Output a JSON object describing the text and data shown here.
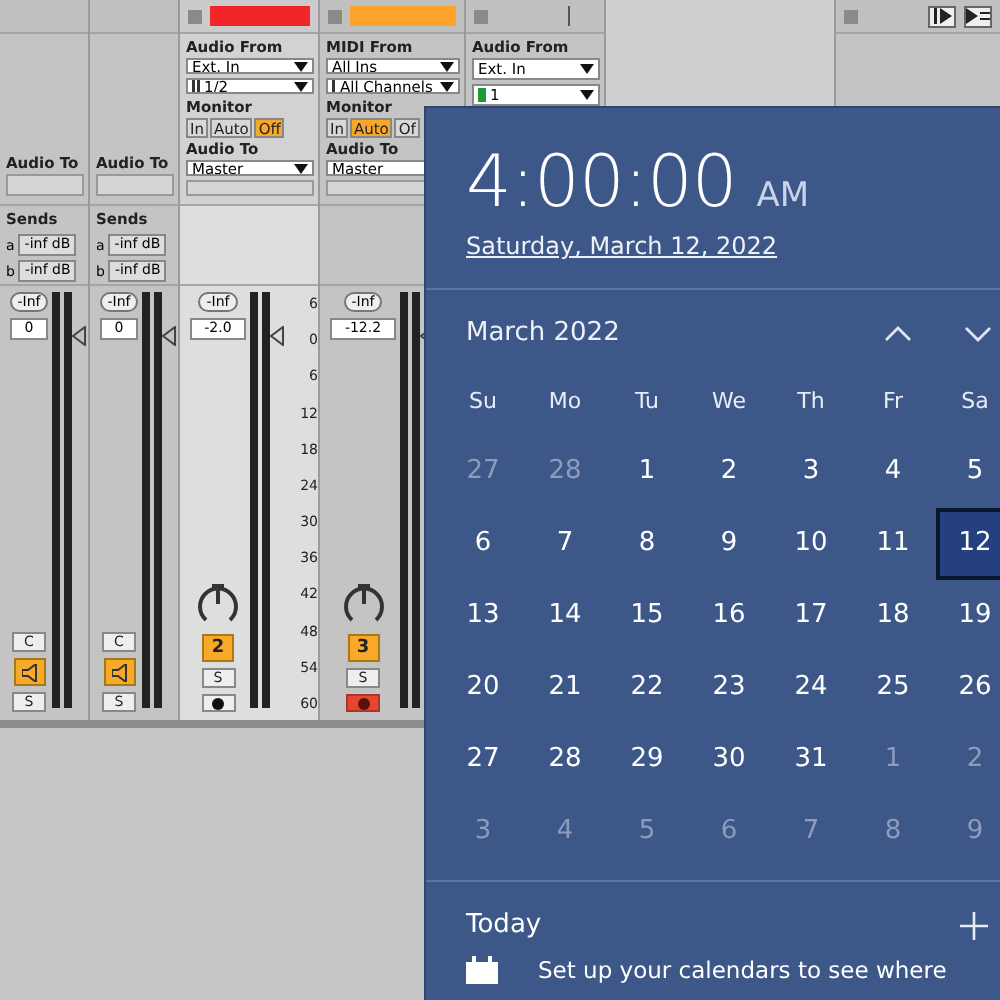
{
  "tracks": [
    {
      "kind": "return",
      "selected": false,
      "io": {
        "to_label": "Audio To"
      },
      "sends_label": "Sends",
      "sends": [
        {
          "letter": "a",
          "value": "-inf dB"
        },
        {
          "letter": "b",
          "value": "-inf dB"
        }
      ],
      "mixer": {
        "peak": "-Inf",
        "volume": "0",
        "pan": {
          "kind": "button",
          "label": "C"
        },
        "activator": {
          "kind": "speaker"
        },
        "solo": "S"
      }
    },
    {
      "kind": "return",
      "selected": false,
      "io": {
        "to_label": "Audio To"
      },
      "sends_label": "Sends",
      "sends": [
        {
          "letter": "a",
          "value": "-inf dB"
        },
        {
          "letter": "b",
          "value": "-inf dB"
        }
      ],
      "mixer": {
        "peak": "-Inf",
        "volume": "0",
        "pan": {
          "kind": "button",
          "label": "C"
        },
        "activator": {
          "kind": "speaker"
        },
        "solo": "S"
      }
    },
    {
      "kind": "audio",
      "selected": true,
      "clip": {
        "kind": "bar",
        "color": "#f0262b"
      },
      "io": {
        "from_label": "Audio From",
        "from": "Ext. In",
        "channel": {
          "kind": "stereo",
          "label": "1/2"
        },
        "monitor_label": "Monitor",
        "monitor": [
          {
            "label": "In",
            "selected": false
          },
          {
            "label": "Auto",
            "selected": false
          },
          {
            "label": "Off",
            "selected": true
          }
        ],
        "to_label": "Audio To",
        "to": "Master"
      },
      "mixer": {
        "peak": "-Inf",
        "volume": "-2.0",
        "scale": [
          "6",
          "0",
          "6",
          "12",
          "18",
          "24",
          "30",
          "36",
          "42",
          "48",
          "54",
          "60"
        ],
        "pan": {
          "kind": "knob"
        },
        "activator": {
          "kind": "number",
          "label": "2"
        },
        "solo": "S",
        "armed": false
      }
    },
    {
      "kind": "midi",
      "selected": false,
      "clip": {
        "kind": "bar",
        "color": "#ffa42a"
      },
      "io": {
        "from_label": "MIDI From",
        "from": "All Ins",
        "channel": {
          "kind": "midi",
          "label": "All Channels"
        },
        "monitor_label": "Monitor",
        "monitor": [
          {
            "label": "In",
            "selected": false
          },
          {
            "label": "Auto",
            "selected": true
          },
          {
            "label": "Of",
            "selected": false
          }
        ],
        "to_label": "Audio To",
        "to": "Master"
      },
      "mixer": {
        "peak": "-Inf",
        "volume": "-12.2",
        "pan": {
          "kind": "knob"
        },
        "activator": {
          "kind": "number",
          "label": "3"
        },
        "solo": "S",
        "armed": true
      }
    },
    {
      "kind": "audio",
      "selected": false,
      "clip": {
        "kind": "empty"
      },
      "io": {
        "from_label": "Audio From",
        "from": "Ext. In",
        "channel": {
          "kind": "mono",
          "label": "1"
        }
      }
    }
  ],
  "clock": {
    "time": "4:00:00",
    "period": "AM",
    "date": "Saturday, March 12, 2022"
  },
  "calendar": {
    "month": "March 2022",
    "weekdays": [
      "Su",
      "Mo",
      "Tu",
      "We",
      "Th",
      "Fr",
      "Sa"
    ],
    "weeks": [
      [
        {
          "day": "27",
          "in_month": false,
          "selected": false
        },
        {
          "day": "28",
          "in_month": false,
          "selected": false
        },
        {
          "day": "1",
          "in_month": true,
          "selected": false
        },
        {
          "day": "2",
          "in_month": true,
          "selected": false
        },
        {
          "day": "3",
          "in_month": true,
          "selected": false
        },
        {
          "day": "4",
          "in_month": true,
          "selected": false
        },
        {
          "day": "5",
          "in_month": true,
          "selected": false
        }
      ],
      [
        {
          "day": "6",
          "in_month": true,
          "selected": false
        },
        {
          "day": "7",
          "in_month": true,
          "selected": false
        },
        {
          "day": "8",
          "in_month": true,
          "selected": false
        },
        {
          "day": "9",
          "in_month": true,
          "selected": false
        },
        {
          "day": "10",
          "in_month": true,
          "selected": false
        },
        {
          "day": "11",
          "in_month": true,
          "selected": false
        },
        {
          "day": "12",
          "in_month": true,
          "selected": true
        }
      ],
      [
        {
          "day": "13",
          "in_month": true,
          "selected": false
        },
        {
          "day": "14",
          "in_month": true,
          "selected": false
        },
        {
          "day": "15",
          "in_month": true,
          "selected": false
        },
        {
          "day": "16",
          "in_month": true,
          "selected": false
        },
        {
          "day": "17",
          "in_month": true,
          "selected": false
        },
        {
          "day": "18",
          "in_month": true,
          "selected": false
        },
        {
          "day": "19",
          "in_month": true,
          "selected": false
        }
      ],
      [
        {
          "day": "20",
          "in_month": true,
          "selected": false
        },
        {
          "day": "21",
          "in_month": true,
          "selected": false
        },
        {
          "day": "22",
          "in_month": true,
          "selected": false
        },
        {
          "day": "23",
          "in_month": true,
          "selected": false
        },
        {
          "day": "24",
          "in_month": true,
          "selected": false
        },
        {
          "day": "25",
          "in_month": true,
          "selected": false
        },
        {
          "day": "26",
          "in_month": true,
          "selected": false
        }
      ],
      [
        {
          "day": "27",
          "in_month": true,
          "selected": false
        },
        {
          "day": "28",
          "in_month": true,
          "selected": false
        },
        {
          "day": "29",
          "in_month": true,
          "selected": false
        },
        {
          "day": "30",
          "in_month": true,
          "selected": false
        },
        {
          "day": "31",
          "in_month": true,
          "selected": false
        },
        {
          "day": "1",
          "in_month": false,
          "selected": false
        },
        {
          "day": "2",
          "in_month": false,
          "selected": false
        }
      ],
      [
        {
          "day": "3",
          "in_month": false,
          "selected": false
        },
        {
          "day": "4",
          "in_month": false,
          "selected": false
        },
        {
          "day": "5",
          "in_month": false,
          "selected": false
        },
        {
          "day": "6",
          "in_month": false,
          "selected": false
        },
        {
          "day": "7",
          "in_month": false,
          "selected": false
        },
        {
          "day": "8",
          "in_month": false,
          "selected": false
        },
        {
          "day": "9",
          "in_month": false,
          "selected": false
        }
      ]
    ]
  },
  "agenda": {
    "title": "Today",
    "message": "Set up your calendars to see where"
  }
}
